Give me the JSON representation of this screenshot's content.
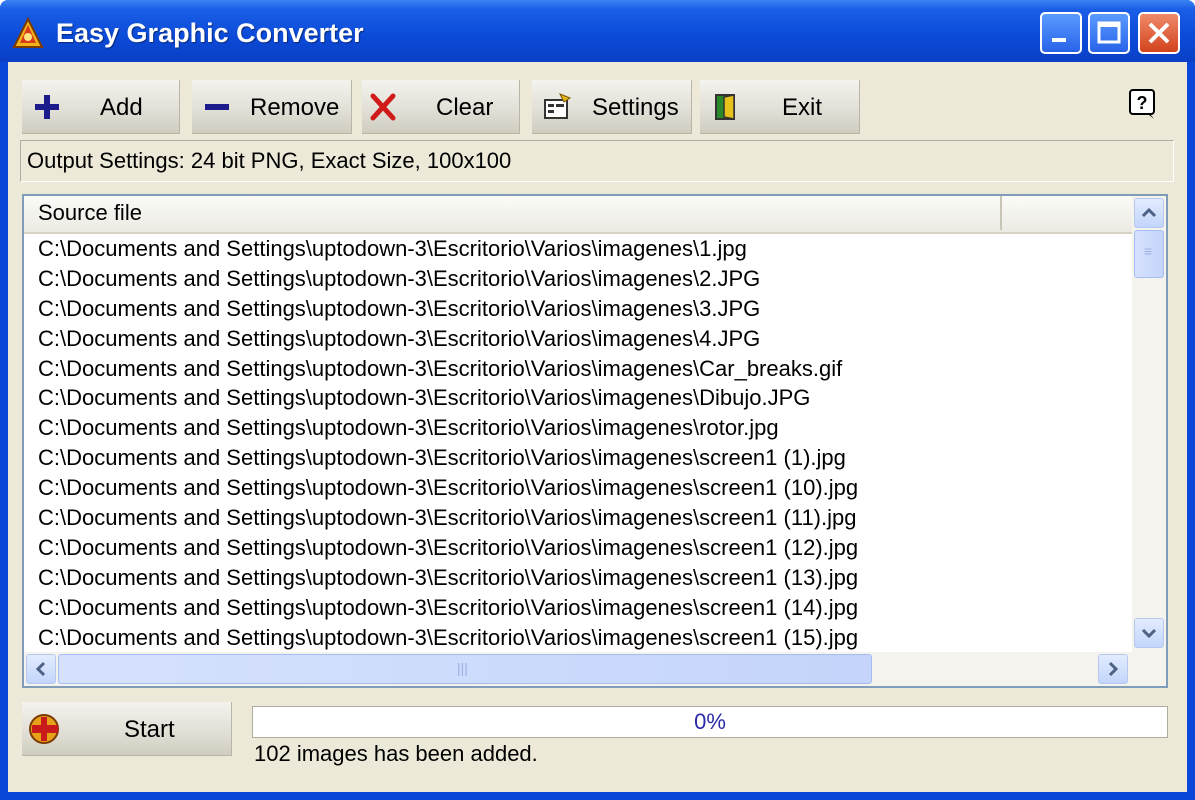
{
  "window": {
    "title": "Easy Graphic Converter"
  },
  "toolbar": {
    "add_label": "Add",
    "remove_label": "Remove",
    "clear_label": "Clear",
    "settings_label": "Settings",
    "exit_label": "Exit"
  },
  "output_settings": "Output Settings: 24 bit PNG, Exact Size, 100x100",
  "list": {
    "columns": [
      "Source file",
      ""
    ],
    "rows": [
      "C:\\Documents and Settings\\uptodown-3\\Escritorio\\Varios\\imagenes\\1.jpg",
      "C:\\Documents and Settings\\uptodown-3\\Escritorio\\Varios\\imagenes\\2.JPG",
      "C:\\Documents and Settings\\uptodown-3\\Escritorio\\Varios\\imagenes\\3.JPG",
      "C:\\Documents and Settings\\uptodown-3\\Escritorio\\Varios\\imagenes\\4.JPG",
      "C:\\Documents and Settings\\uptodown-3\\Escritorio\\Varios\\imagenes\\Car_breaks.gif",
      "C:\\Documents and Settings\\uptodown-3\\Escritorio\\Varios\\imagenes\\Dibujo.JPG",
      "C:\\Documents and Settings\\uptodown-3\\Escritorio\\Varios\\imagenes\\rotor.jpg",
      "C:\\Documents and Settings\\uptodown-3\\Escritorio\\Varios\\imagenes\\screen1 (1).jpg",
      "C:\\Documents and Settings\\uptodown-3\\Escritorio\\Varios\\imagenes\\screen1 (10).jpg",
      "C:\\Documents and Settings\\uptodown-3\\Escritorio\\Varios\\imagenes\\screen1 (11).jpg",
      "C:\\Documents and Settings\\uptodown-3\\Escritorio\\Varios\\imagenes\\screen1 (12).jpg",
      "C:\\Documents and Settings\\uptodown-3\\Escritorio\\Varios\\imagenes\\screen1 (13).jpg",
      "C:\\Documents and Settings\\uptodown-3\\Escritorio\\Varios\\imagenes\\screen1 (14).jpg",
      "C:\\Documents and Settings\\uptodown-3\\Escritorio\\Varios\\imagenes\\screen1 (15).jpg"
    ]
  },
  "start_label": "Start",
  "progress": {
    "value": 0,
    "text": "0%"
  },
  "status": "102 images has been added.",
  "colors": {
    "titlebar": "#0a47d8",
    "face": "#ece9d8",
    "progress_text": "#2a2aa8"
  },
  "icons": [
    "app-icon",
    "minimize-icon",
    "maximize-icon",
    "close-icon",
    "plus-icon",
    "minus-icon",
    "x-icon",
    "settings-icon",
    "exit-door-icon",
    "help-icon",
    "start-icon"
  ]
}
